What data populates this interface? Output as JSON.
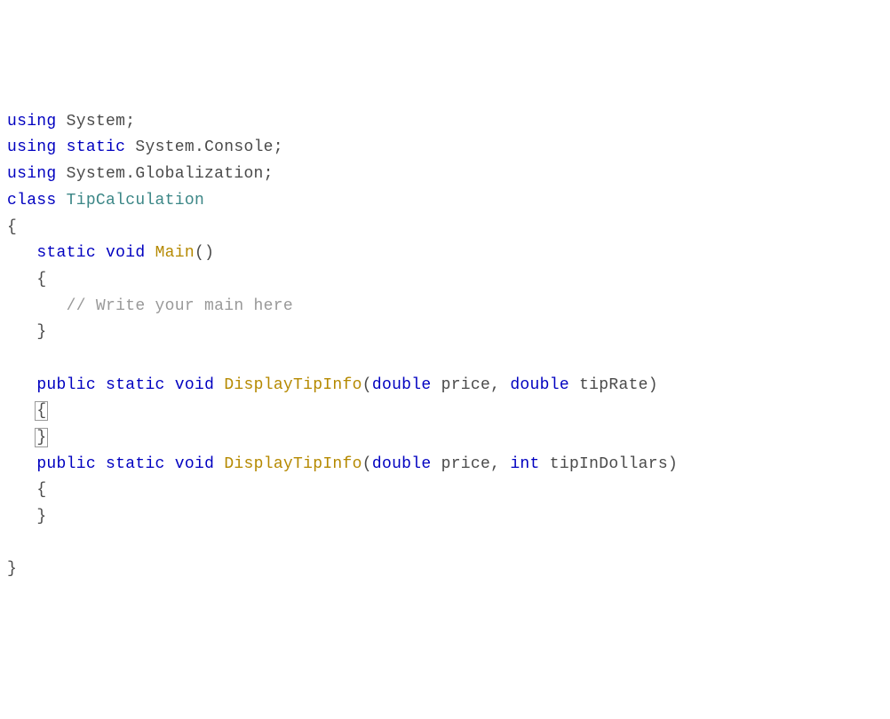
{
  "code": {
    "line1": {
      "using": "using",
      "ns": "System",
      "semi": ";"
    },
    "line2": {
      "using": "using",
      "static": "static",
      "ns": "System.Console",
      "semi": ";"
    },
    "line3": {
      "using": "using",
      "ns": "System.Globalization",
      "semi": ";"
    },
    "line4": {
      "class": "class",
      "name": "TipCalculation"
    },
    "line5": {
      "brace": "{"
    },
    "line6": {
      "static": "static",
      "void": "void",
      "method": "Main",
      "parens": "()"
    },
    "line7": {
      "brace": "{"
    },
    "line8": {
      "comment": "// Write your main here"
    },
    "line9": {
      "brace": "}"
    },
    "line10": {
      "blank": ""
    },
    "line11": {
      "public": "public",
      "static": "static",
      "void": "void",
      "method": "DisplayTipInfo",
      "open": "(",
      "type1": "double",
      "param1": "price",
      "comma": ",",
      "type2": "double",
      "param2": "tipRate",
      "close": ")"
    },
    "line12": {
      "brace": "{"
    },
    "line13": {
      "brace": "}"
    },
    "line14": {
      "public": "public",
      "static": "static",
      "void": "void",
      "method": "DisplayTipInfo",
      "open": "(",
      "type1": "double",
      "param1": "price",
      "comma": ",",
      "type2": "int",
      "param2": "tipInDollars",
      "close": ")"
    },
    "line15": {
      "brace": "{"
    },
    "line16": {
      "brace": "}"
    },
    "line17": {
      "blank": ""
    },
    "line18": {
      "brace": "}"
    }
  }
}
